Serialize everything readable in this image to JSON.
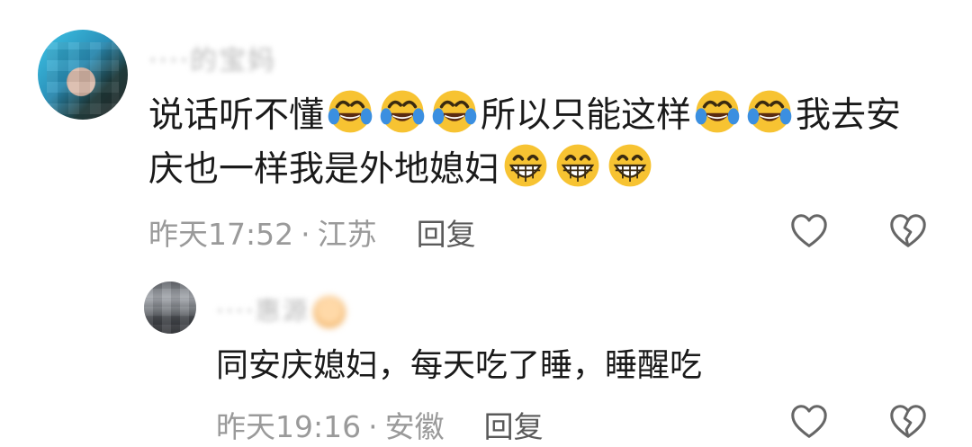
{
  "comment": {
    "username": "····的宝妈",
    "text_parts_line1": [
      "说话听不懂",
      "所以只能这样",
      "我去安"
    ],
    "text_parts_line2": [
      "庆也一样我是外地媳妇"
    ],
    "emojis": [
      "rofl-emoji",
      "grin-emoji"
    ],
    "time": "昨天17:52",
    "location": "江苏",
    "reply_label": "回复"
  },
  "reply": {
    "username": "····惠源",
    "text": "同安庆媳妇，每天吃了睡，睡醒吃",
    "time": "昨天19:16",
    "location": "安徽",
    "reply_label": "回复"
  },
  "separator": "·",
  "icons": {
    "like": "heart-outline-icon",
    "dislike": "broken-heart-icon"
  },
  "colors": {
    "text": "#1a1a1a",
    "meta": "#9a9a9a",
    "reply_button": "#5a5a5a",
    "emoji_yellow": "#f7c332"
  }
}
